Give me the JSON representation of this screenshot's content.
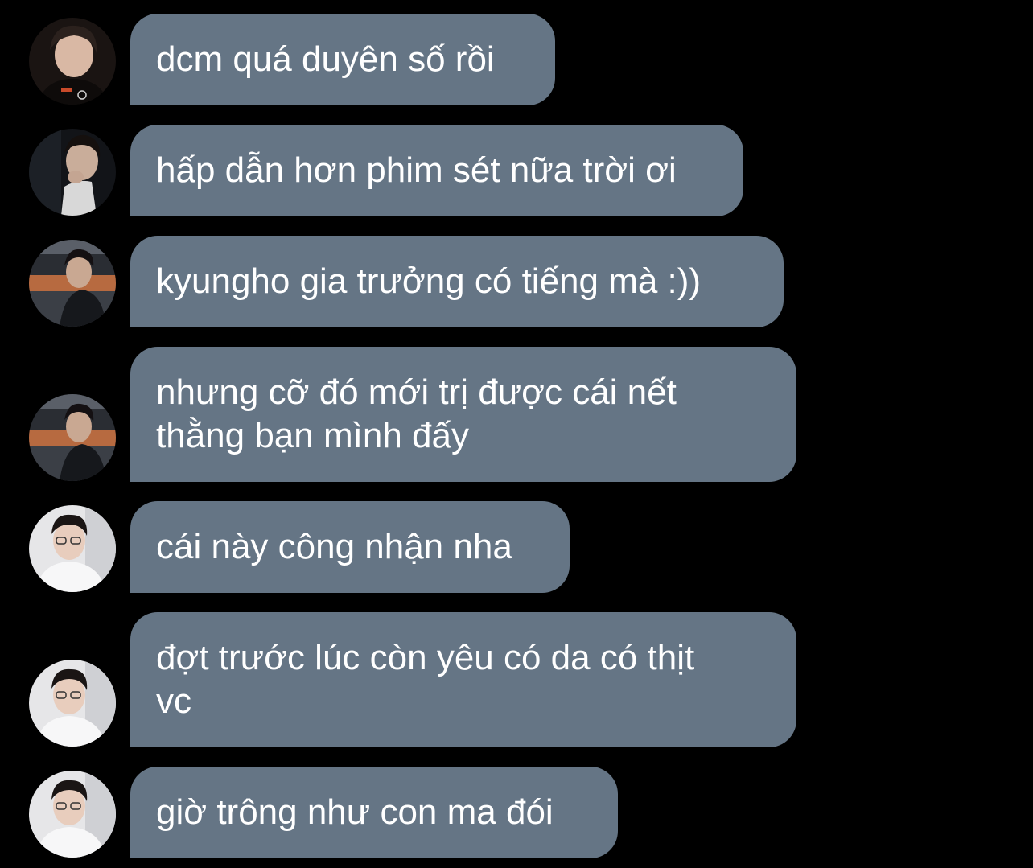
{
  "theme": {
    "background": "#000000",
    "bubble_color": "#657585",
    "text_color": "#ffffff"
  },
  "messages": [
    {
      "text": "dcm quá duyên số rồi",
      "avatar": "user-a-avatar"
    },
    {
      "text": "hấp dẫn hơn phim sét nữa trời ơi",
      "avatar": "user-b-avatar"
    },
    {
      "text": "kyungho gia trưởng có tiếng mà :))",
      "avatar": "user-c-avatar"
    },
    {
      "text": "nhưng cỡ đó mới trị được cái nết\nthằng bạn mình đấy",
      "avatar": "user-c-avatar"
    },
    {
      "text": "cái này công nhận nha",
      "avatar": "user-d-avatar"
    },
    {
      "text": "đợt trước lúc còn yêu có da có thịt\nvc",
      "avatar": "user-d-avatar"
    },
    {
      "text": "giờ trông như con ma đói",
      "avatar": "user-d-avatar"
    }
  ]
}
